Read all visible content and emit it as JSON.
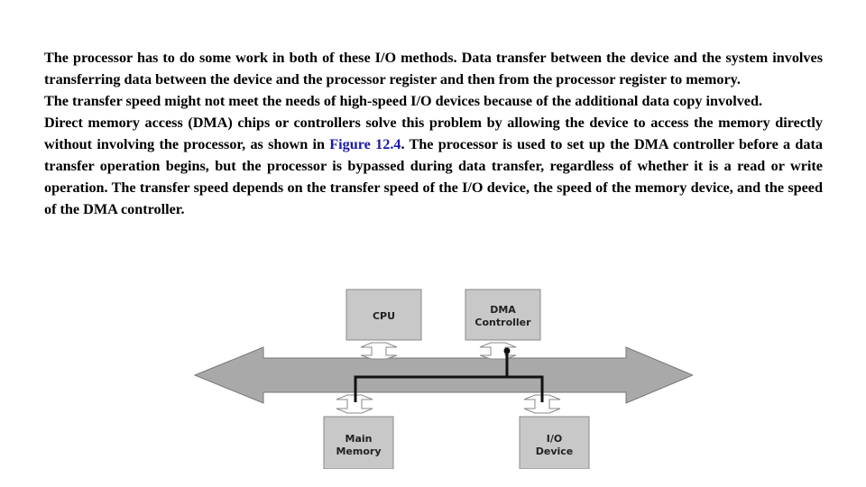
{
  "paragraphs": [
    {
      "text": "The processor has to do some work in both of these I/O methods. Data transfer between the device and the system  involves transferring data between the device and the processor register and then from the processor register to  memory."
    },
    {
      "text": "The transfer speed might not meet the needs of high-speed I/O devices because of the additional data copy  involved."
    },
    {
      "text_before": "Direct memory access (DMA) chips or controllers solve this problem by allowing the device to access the memory directly without involving the processor, as shown in ",
      "link": "Figure 12.4",
      "text_after": ". The processor is used to set up the DMA controller before a data transfer operation begins, but the processor is bypassed during data transfer, regardless of  whether it is a read or write operation. The transfer speed depends on the transfer speed of the I/O device, the speed  of the memory device, and the speed of the DMA controller."
    }
  ],
  "colors": {
    "text": "#000000",
    "link": "#1a1aa6",
    "box_fill": "#c8c8c8",
    "bus_fill": "#a9a9a9"
  },
  "diagram": {
    "boxes": {
      "cpu": {
        "line1": "CPU",
        "line2": ""
      },
      "dma": {
        "line1": "DMA",
        "line2": "Controller"
      },
      "memory": {
        "line1": "Main",
        "line2": "Memory"
      },
      "io": {
        "line1": "I/O",
        "line2": "Device"
      }
    }
  }
}
